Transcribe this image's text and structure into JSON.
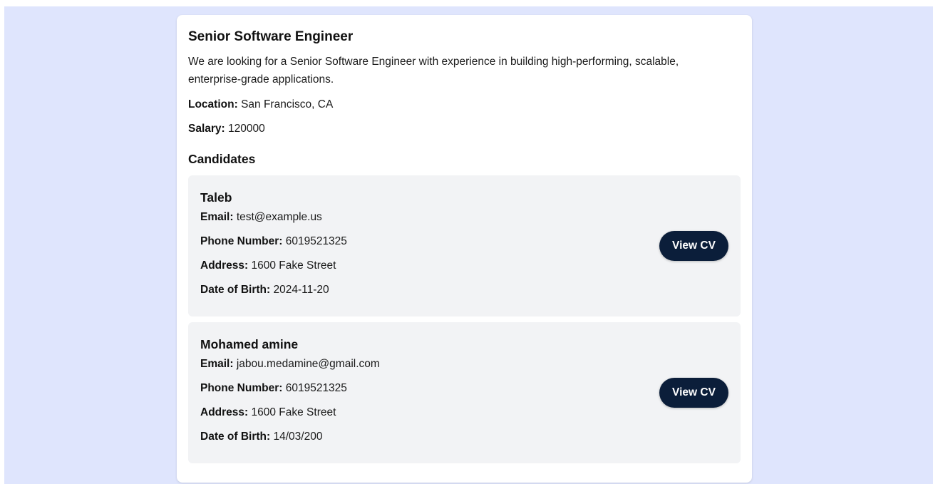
{
  "job": {
    "title": "Senior Software Engineer",
    "description": "We are looking for a Senior Software Engineer with experience in building high-performing, scalable, enterprise-grade applications.",
    "location_label": "Location:",
    "location": "San Francisco, CA",
    "salary_label": "Salary:",
    "salary": "120000"
  },
  "candidates_heading": "Candidates",
  "labels": {
    "email": "Email:",
    "phone": "Phone Number:",
    "address": "Address:",
    "dob": "Date of Birth:",
    "view_cv": "View CV"
  },
  "candidates": [
    {
      "name": "Taleb",
      "email": "test@example.us",
      "phone": "6019521325",
      "address": "1600 Fake Street",
      "dob": "2024-11-20"
    },
    {
      "name": "Mohamed amine",
      "email": "jabou.medamine@gmail.com",
      "phone": "6019521325",
      "address": "1600 Fake Street",
      "dob": "14/03/200"
    }
  ],
  "colors": {
    "page_background": "#dfe5fd",
    "card_background": "#ffffff",
    "candidate_background": "#f2f3f5",
    "button_background": "#0b1e3a",
    "button_text": "#ffffff"
  }
}
